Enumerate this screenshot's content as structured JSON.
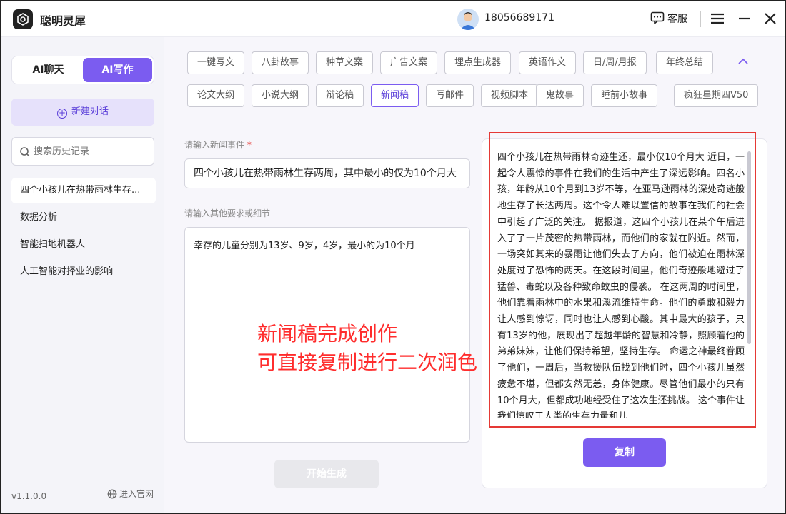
{
  "app": {
    "title": "聪明灵犀",
    "phone": "18056689171",
    "service_label": "客服"
  },
  "sidebar": {
    "mode_tabs": [
      "AI聊天",
      "AI写作"
    ],
    "active_mode": "AI写作",
    "new_chat_label": "新建对话",
    "search_placeholder": "搜索历史记录",
    "history": [
      "四个小孩儿在热带雨林生存...",
      "数据分析",
      "智能扫地机器人",
      "人工智能对择业的影响"
    ],
    "version": "v1.1.0.0",
    "official_site_label": "进入官网"
  },
  "categories": {
    "row1": [
      "一键写文",
      "八卦故事",
      "种草文案",
      "广告文案",
      "埋点生成器",
      "英语作文",
      "日/周/月报",
      "年终总结"
    ],
    "row2": [
      "论文大纲",
      "小说大纲",
      "辩论稿",
      "新闻稿",
      "写邮件",
      "视频脚本",
      "鬼故事",
      "睡前小故事",
      "疯狂星期四V50"
    ],
    "active": "新闻稿"
  },
  "form": {
    "event_label": "请输入新闻事件",
    "required_mark": "*",
    "event_value": "四个小孩儿在热带雨林生存两周，其中最小的仅为10个月大",
    "detail_label": "请输入其他要求或细节",
    "detail_value": "幸存的儿童分别为13岁、9岁，4岁，最小的为10个月",
    "start_label": "开始生成"
  },
  "annotation": {
    "line1": "新闻稿完成创作",
    "line2": "可直接复制进行二次润色"
  },
  "output": {
    "text": "四个小孩儿在热带雨林奇迹生还，最小仅10个月大 近日，一起令人震惊的事件在我们的生活中产生了深远影响。四名小孩，年龄从10个月到13岁不等，在亚马逊雨林的深处奇迹般地生存了长达两周。这个令人难以置信的故事在我们的社会中引起了广泛的关注。 据报道，这四个小孩儿在某个午后进入了了一片茂密的热带雨林，而他们的家就在附近。然而，一场突如其来的暴雨让他们失去了方向，他们被迫在雨林深处度过了恐怖的两天。在这段时间里，他们奇迹般地避过了猛兽、毒蛇以及各种致命蚊虫的侵袭。 在这两周的时间里，他们靠着雨林中的水果和溪流维持生命。他们的勇敢和毅力让人感到惊讶，同时也让人感到心酸。其中最大的孩子，只有13岁的他，展现出了超越年龄的智慧和冷静，照顾着他的弟弟妹妹，让他们保持希望，坚持生存。 命运之神最终眷顾了他们，一周后，当救援队伍找到他们时，四个小孩儿虽然疲惫不堪，但都安然无恙，身体健康。尽管他们最小的只有10个月大，但都成功地经受住了这次生还挑战。 这个事件让我们惊叹于人类的生存力量和儿",
    "copy_label": "复制"
  },
  "colors": {
    "accent": "#7b5cf0",
    "annotation": "#ff2d2d",
    "highlight_box": "#e53935"
  },
  "icons": [
    "app-logo-icon",
    "avatar-icon",
    "chat-bubble-icon",
    "menu-icon",
    "minimize-icon",
    "close-icon",
    "plus-circle-icon",
    "search-icon",
    "chevron-up-icon",
    "globe-icon"
  ]
}
